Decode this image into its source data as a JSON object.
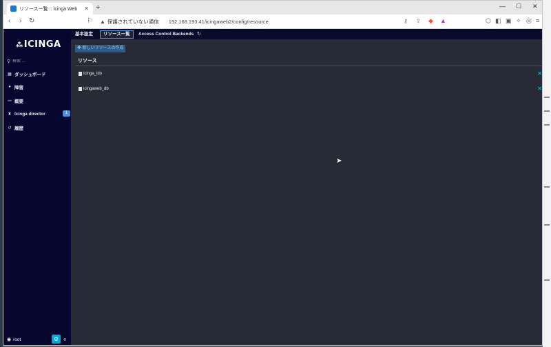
{
  "browser": {
    "tab_title": "リソース一覧 :: Icinga Web",
    "new_tab": "+",
    "address_warning": "保護されていない通信",
    "url": "192.168.193.41/icingaweb2/config/resource"
  },
  "app": {
    "logo": "icinga",
    "search_placeholder": "検索 ...",
    "nav": [
      {
        "label": "ダッシュボード",
        "icon": "dashboard-icon"
      },
      {
        "label": "障害",
        "icon": "problems-icon"
      },
      {
        "label": "概要",
        "icon": "overview-icon"
      },
      {
        "label": "Icinga director",
        "icon": "director-icon",
        "badge": "1"
      },
      {
        "label": "履歴",
        "icon": "history-icon"
      }
    ],
    "user": "root"
  },
  "main": {
    "tabs": [
      "基本設定",
      "リソース一覧",
      "Access Control Backends"
    ],
    "active_tab": "リソース一覧",
    "create_button": "新しいリソースの作成",
    "section_title": "リソース",
    "resources": [
      "icinga_ido",
      "icingaweb_db"
    ]
  },
  "colors": {
    "sidebar_bg": "#06062e",
    "main_bg": "#262b35",
    "accent": "#00a8d6",
    "badge": "#4a8fe7"
  }
}
